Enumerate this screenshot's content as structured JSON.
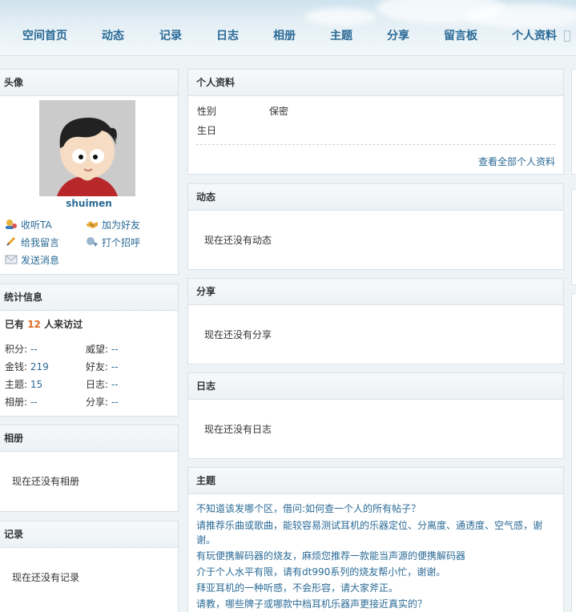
{
  "nav": {
    "items": [
      "空间首页",
      "动态",
      "记录",
      "日志",
      "相册",
      "主题",
      "分享",
      "留言板",
      "个人资料"
    ]
  },
  "avatar_panel": {
    "title": "头像",
    "username": "shuimen",
    "actions": {
      "follow": "收听TA",
      "add_friend": "加为好友",
      "leave_message": "给我留言",
      "greet": "打个招呼",
      "send_message": "发送消息"
    }
  },
  "stats_panel": {
    "title": "统计信息",
    "visit_prefix": "已有",
    "visit_count": "12",
    "visit_suffix": "人来访过",
    "items": [
      {
        "label": "积分:",
        "value": "--"
      },
      {
        "label": "威望:",
        "value": "--"
      },
      {
        "label": "金钱:",
        "value": "219"
      },
      {
        "label": "好友:",
        "value": "--"
      },
      {
        "label": "主题:",
        "value": "15"
      },
      {
        "label": "日志:",
        "value": "--"
      },
      {
        "label": "相册:",
        "value": "--"
      },
      {
        "label": "分享:",
        "value": "--"
      }
    ]
  },
  "album_panel": {
    "title": "相册",
    "empty": "现在还没有相册"
  },
  "record_panel": {
    "title": "记录",
    "empty": "现在还没有记录"
  },
  "profile_panel": {
    "title": "个人资料",
    "gender_label": "性别",
    "gender_value": "保密",
    "birthday_label": "生日",
    "view_all": "查看全部个人资料"
  },
  "feed_panel": {
    "title": "动态",
    "empty": "现在还没有动态"
  },
  "share_panel": {
    "title": "分享",
    "empty": "现在还没有分享"
  },
  "blog_panel": {
    "title": "日志",
    "empty": "现在还没有日志"
  },
  "threads_panel": {
    "title": "主题",
    "threads": [
      "不知道该发哪个区，借问:如何查一个人的所有帖子？",
      "请推荐乐曲或歌曲，能较容易测试耳机的乐器定位、分离度、通透度、空气感，谢",
      "谢。",
      "有玩便携解码器的烧友，麻烦您推荐一款能当声源的便携解码器",
      "介于个人水平有限，请有dt990系列的烧友帮小忙，谢谢。",
      "拜亚耳机的一种听感，不会形容，请大家斧正。",
      "请教，哪些牌子或哪款中档耳机乐器声更接近真实的？"
    ]
  }
}
